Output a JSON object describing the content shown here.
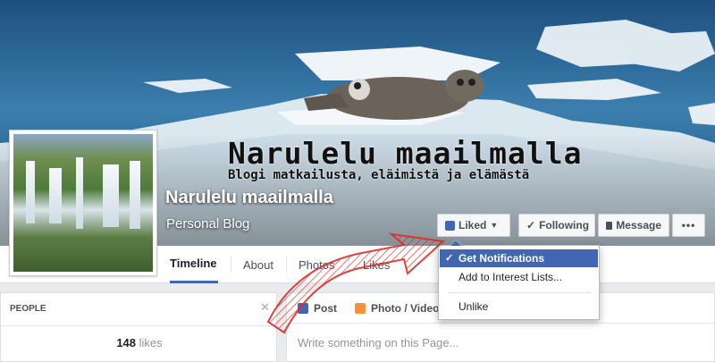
{
  "cover": {
    "title": "Narulelu maailmalla",
    "subtitle": "Blogi matkailusta, eläimistä ja elämästä"
  },
  "profile": {
    "name": "Narulelu maailmalla",
    "category": "Personal Blog"
  },
  "actions": {
    "liked": "Liked",
    "following": "Following",
    "message": "Message",
    "more": "•••"
  },
  "tabs": [
    {
      "label": "Timeline",
      "active": true
    },
    {
      "label": "About"
    },
    {
      "label": "Photos"
    },
    {
      "label": "Likes"
    }
  ],
  "dropdown": {
    "items": [
      "Get Notifications",
      "Add to Interest Lists...",
      "Unlike"
    ],
    "checked": "Get Notifications",
    "check_mark": "✓"
  },
  "people": {
    "heading": "PEOPLE",
    "likes_count": "148",
    "likes_label": "likes",
    "close": "✕"
  },
  "composer": {
    "post_tab": "Post",
    "photo_tab": "Photo / Video",
    "placeholder": "Write something on this Page..."
  },
  "colors": {
    "accent": "#4267b2",
    "arrow": "#d9302a"
  }
}
